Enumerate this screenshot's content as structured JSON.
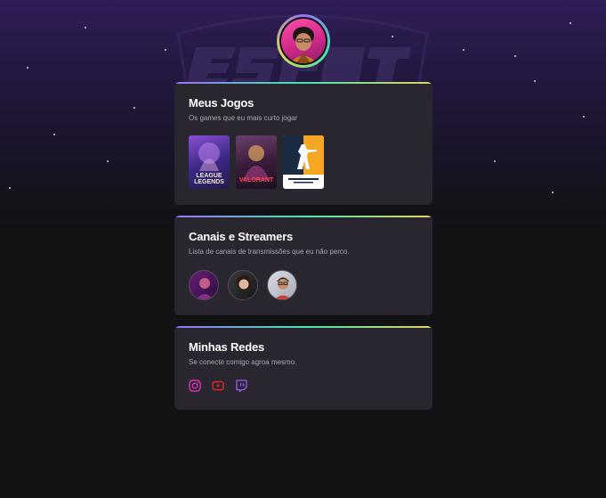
{
  "profile": {
    "avatar_alt": "avatar"
  },
  "games_card": {
    "title": "Meus Jogos",
    "subtitle": "Os games que eu mais curto jogar",
    "games": [
      {
        "name": "League of Legends",
        "logo_text_1": "LEAGUE",
        "logo_text_2": "LEGENDS"
      },
      {
        "name": "Valorant",
        "logo_text": "VALORANT"
      },
      {
        "name": "Counter-Strike",
        "logo_text": "COUNTER STRIKE"
      }
    ]
  },
  "streamers_card": {
    "title": "Canais e Streamers",
    "subtitle": "Lista de canais de transmissões que eu não perco."
  },
  "socials_card": {
    "title": "Minhas Redes",
    "subtitle": "Se conecte comigo agroa mesmo.",
    "icons": [
      "instagram-icon",
      "youtube-icon",
      "twitch-icon"
    ]
  },
  "colors": {
    "background": "#121214",
    "card": "#29262f",
    "accent_purple": "#9572fc",
    "accent_green": "#43e7ad",
    "accent_yellow": "#e2d45c",
    "social_pink": "#d534b4"
  }
}
